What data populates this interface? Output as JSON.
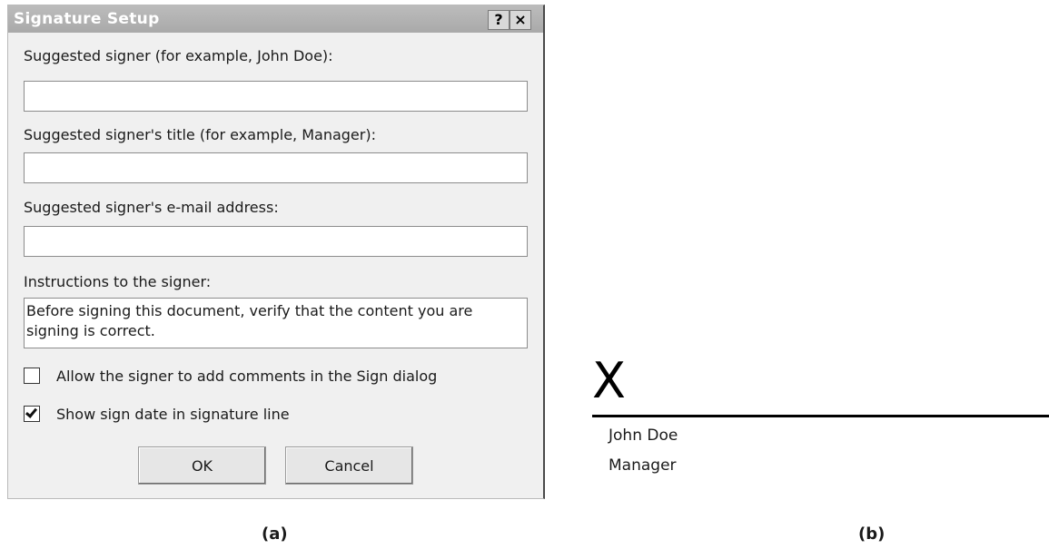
{
  "dialog": {
    "title": "Signature Setup",
    "help_button": "?",
    "close_button": "×",
    "signer_label": "Suggested signer (for example, John Doe):",
    "signer_value": "",
    "title_label": "Suggested signer's title (for example, Manager):",
    "title_value": "",
    "email_label": "Suggested signer's e-mail address:",
    "email_value": "",
    "instructions_label": "Instructions to the signer:",
    "instructions_value": "Before signing this document, verify that the content you are signing is correct.",
    "allow_comments_label": "Allow the signer to add comments in the Sign dialog",
    "allow_comments_checked": false,
    "show_date_label": "Show sign date in signature line",
    "show_date_checked": true,
    "ok_label": "OK",
    "cancel_label": "Cancel"
  },
  "signature_line": {
    "mark": "X",
    "name": "John Doe",
    "title": "Manager"
  },
  "captions": {
    "a": "(a)",
    "b": "(b)"
  }
}
